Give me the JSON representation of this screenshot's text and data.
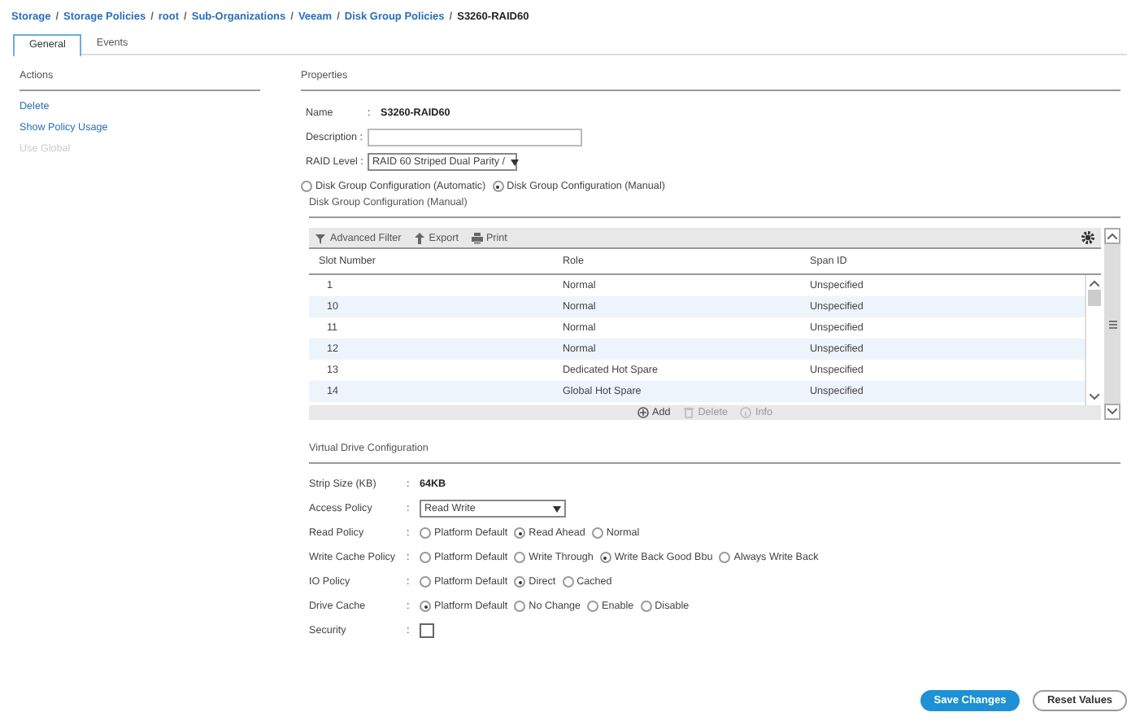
{
  "breadcrumb": [
    {
      "kind": "link",
      "label": "Storage",
      "current": false
    },
    {
      "kind": "separator",
      "label": "/"
    },
    {
      "kind": "link",
      "label": "Storage Policies",
      "current": false
    },
    {
      "kind": "separator",
      "label": "/"
    },
    {
      "kind": "link",
      "label": "root",
      "current": false
    },
    {
      "kind": "separator",
      "label": "/"
    },
    {
      "kind": "link",
      "label": "Sub-Organizations",
      "current": false
    },
    {
      "kind": "separator",
      "label": "/"
    },
    {
      "kind": "link",
      "label": "Veeam",
      "current": false
    },
    {
      "kind": "separator",
      "label": "/"
    },
    {
      "kind": "link",
      "label": "Disk Group Policies",
      "current": false
    },
    {
      "kind": "separator",
      "label": "/"
    },
    {
      "kind": "link",
      "label": "S3260-RAID60",
      "current": true
    }
  ],
  "tabs": [
    {
      "label": "General",
      "selected": true
    },
    {
      "label": "Events",
      "selected": false
    }
  ],
  "actions": {
    "title": "Actions",
    "items": [
      {
        "label": "Delete",
        "disabled": false
      },
      {
        "label": "Show Policy Usage",
        "disabled": false
      },
      {
        "label": "Use Global",
        "disabled": true
      }
    ]
  },
  "properties": {
    "title": "Properties",
    "name": {
      "label": "Name",
      "colon": ":",
      "value": "S3260-RAID60"
    },
    "description": {
      "label": "Description :"
    },
    "raid_level": {
      "label": "RAID Level :",
      "value": "RAID 60 Striped Dual Parity /"
    },
    "config_mode": [
      {
        "label": "Disk Group Configuration (Automatic)",
        "selected": false
      },
      {
        "label": "Disk Group Configuration (Manual)",
        "selected": true
      }
    ]
  },
  "disk_group": {
    "title": "Disk Group Configuration (Manual)",
    "toolbar": [
      {
        "kind": "filter",
        "label": "Advanced Filter"
      },
      {
        "kind": "export",
        "label": "Export"
      },
      {
        "kind": "print",
        "label": "Print"
      }
    ],
    "columns": [
      "Slot Number",
      "Role",
      "Span ID"
    ],
    "rows": [
      [
        "1",
        "Normal",
        "Unspecified"
      ],
      [
        "10",
        "Normal",
        "Unspecified"
      ],
      [
        "11",
        "Normal",
        "Unspecified"
      ],
      [
        "12",
        "Normal",
        "Unspecified"
      ],
      [
        "13",
        "Dedicated Hot Spare",
        "Unspecified"
      ],
      [
        "14",
        "Global Hot Spare",
        "Unspecified"
      ]
    ],
    "footer_actions": [
      {
        "kind": "add",
        "label": "Add",
        "disabled": false
      },
      {
        "kind": "delete",
        "label": "Delete",
        "disabled": true
      },
      {
        "kind": "info",
        "label": "Info",
        "disabled": true
      }
    ]
  },
  "virtual_drive": {
    "title": "Virtual Drive Configuration",
    "fields": [
      {
        "kind": "text",
        "label": "Strip Size (KB)",
        "colon": ":",
        "value": "64KB"
      },
      {
        "kind": "select",
        "label": "Access Policy",
        "colon": ":",
        "value": "Read Write"
      },
      {
        "kind": "radio",
        "label": "Read Policy",
        "colon": ":",
        "options": [
          {
            "label": "Platform Default",
            "selected": false
          },
          {
            "label": "Read Ahead",
            "selected": true
          },
          {
            "label": "Normal",
            "selected": false
          }
        ]
      },
      {
        "kind": "radio",
        "label": "Write Cache Policy",
        "colon": ":",
        "options": [
          {
            "label": "Platform Default",
            "selected": false
          },
          {
            "label": "Write Through",
            "selected": false
          },
          {
            "label": "Write Back Good Bbu",
            "selected": true
          },
          {
            "label": "Always Write Back",
            "selected": false
          }
        ]
      },
      {
        "kind": "radio",
        "label": "IO Policy",
        "colon": ":",
        "options": [
          {
            "label": "Platform Default",
            "selected": false
          },
          {
            "label": "Direct",
            "selected": true
          },
          {
            "label": "Cached",
            "selected": false
          }
        ]
      },
      {
        "kind": "radio",
        "label": "Drive Cache",
        "colon": ":",
        "options": [
          {
            "label": "Platform Default",
            "selected": true
          },
          {
            "label": "No Change",
            "selected": false
          },
          {
            "label": "Enable",
            "selected": false
          },
          {
            "label": "Disable",
            "selected": false
          }
        ]
      },
      {
        "kind": "checkbox",
        "label": "Security",
        "colon": ":",
        "checked": false
      }
    ]
  },
  "buttons": [
    {
      "kind": "primary",
      "label": "Save Changes"
    },
    {
      "kind": "secondary",
      "label": "Reset Values"
    }
  ]
}
